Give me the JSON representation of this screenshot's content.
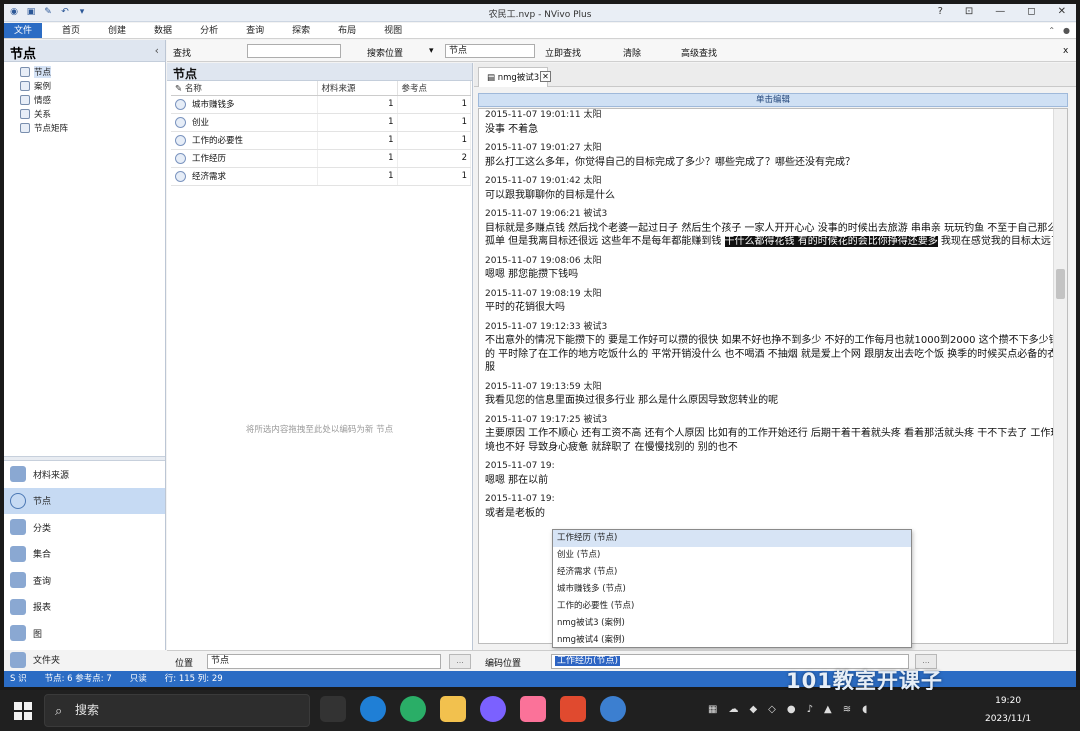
{
  "window": {
    "title": "农民工.nvp - NVivo Plus",
    "controls": [
      "?",
      "⊡",
      "—",
      "◻",
      "✕"
    ]
  },
  "ribbon": {
    "tabs": [
      "文件",
      "首页",
      "创建",
      "数据",
      "分析",
      "查询",
      "探索",
      "布局",
      "视图"
    ]
  },
  "left_panel": {
    "title": "节点",
    "tree": [
      "节点",
      "案例",
      "情感",
      "关系",
      "节点矩阵"
    ],
    "nav": [
      "材料来源",
      "节点",
      "分类",
      "集合",
      "查询",
      "报表",
      "图",
      "文件夹"
    ],
    "active_nav": "节点"
  },
  "find_bar": {
    "look_for_label": "查找",
    "look_for_value": "",
    "search_in_label": "搜索位置",
    "search_in_value": "节点",
    "find_now": "立即查找",
    "clear": "清除",
    "advanced": "高级查找",
    "close": "x"
  },
  "nodes_list": {
    "title": "节点",
    "columns": [
      "名称",
      "材料来源",
      "参考点"
    ],
    "rows": [
      {
        "name": "城市赚钱多",
        "sources": "1",
        "refs": "1"
      },
      {
        "name": "创业",
        "sources": "1",
        "refs": "1"
      },
      {
        "name": "工作的必要性",
        "sources": "1",
        "refs": "1"
      },
      {
        "name": "工作经历",
        "sources": "1",
        "refs": "2"
      },
      {
        "name": "经济需求",
        "sources": "1",
        "refs": "1"
      }
    ],
    "drop_hint": "将所选内容拖拽至此处以编码为新 节点"
  },
  "document": {
    "tab_label": "nmg被试3",
    "tab_close": "✕",
    "edit_bar": "单击编辑",
    "entries": [
      {
        "ts": "2015-11-07 19:01:11 太阳",
        "text": "没事 不着急"
      },
      {
        "ts": "2015-11-07 19:01:27 太阳",
        "text": "那么打工这么多年，你觉得自己的目标完成了多少？哪些完成了？哪些还没有完成？"
      },
      {
        "ts": "2015-11-07 19:01:42 太阳",
        "text": "可以跟我聊聊你的目标是什么"
      },
      {
        "ts": "2015-11-07 19:06:21 被试3",
        "text": "目标就是多赚点钱 然后找个老婆一起过日子  然后生个孩子  一家人开开心心  没事的时候出去旅游  串串亲  玩玩钓鱼  不至于自己那么孤单  但是我离目标还很远  这些年不是每年都能赚到钱",
        "highlight": "干什么都得花钱 有的时候花的会比你挣得还要多",
        "tail": " 我现在感觉我的目标太远了"
      },
      {
        "ts": "2015-11-07 19:08:06 太阳",
        "text": "嗯嗯  那您能攒下钱吗"
      },
      {
        "ts": "2015-11-07 19:08:19 太阳",
        "text": "平时的花销很大吗"
      },
      {
        "ts": "2015-11-07 19:12:33 被试3",
        "text": "不出意外的情况下能攒下的   要是工作好可以攒的很快  如果不好也挣不到多少  不好的工作每月也就1000到2000   这个攒不下多少钱的    平时除了在工作的地方吃饭什么的   平常开销没什么  也不喝酒  不抽烟  就是爱上个网  跟朋友出去吃个饭  换季的时候买点必备的衣服"
      },
      {
        "ts": "2015-11-07 19:13:59 太阳",
        "text": "我看见您的信息里面换过很多行业 那么是什么原因导致您转业的呢"
      },
      {
        "ts": "2015-11-07 19:17:25 被试3",
        "text": "主要原因 工作不顺心  还有工资不高  还有个人原因  比如有的工作开始还行  后期干着干着就头疼  看着那活就头疼  干不下去了   工作环境也不好 导致身心疲惫  就辞职了  在慢慢找别的  别的也不"
      },
      {
        "ts": "2015-11-07 19:",
        "text": "嗯嗯  那在以前"
      },
      {
        "ts": "2015-11-07 19:",
        "text": "或者是老板的"
      }
    ]
  },
  "dropdown": {
    "options": [
      "工作经历 (节点)",
      "创业 (节点)",
      "经济需求 (节点)",
      "城市赚钱多 (节点)",
      "工作的必要性 (节点)",
      "nmg被试3 (案例)",
      "nmg被试4 (案例)"
    ],
    "selected": "工作经历 (节点)"
  },
  "bottom_bar": {
    "in_label": "位置",
    "in_value": "节点",
    "code_at_label": "编码位置",
    "code_at_value": "工作经历(节点)",
    "mini": "..."
  },
  "status_bar": {
    "user": "S 识",
    "items": "节点: 6 参考点: 7",
    "readonly": "只读",
    "position": "行: 115 列: 29"
  },
  "watermark": "101教室开课子",
  "taskbar": {
    "search_placeholder": "搜索",
    "time": "19:20",
    "date": "2023/11/1",
    "colors": {
      "edge": "#1f7fd6",
      "wechat": "#2aae67",
      "files": "#f2c14e",
      "bilibili": "#fb7299",
      "wps": "#e04a2f"
    }
  }
}
